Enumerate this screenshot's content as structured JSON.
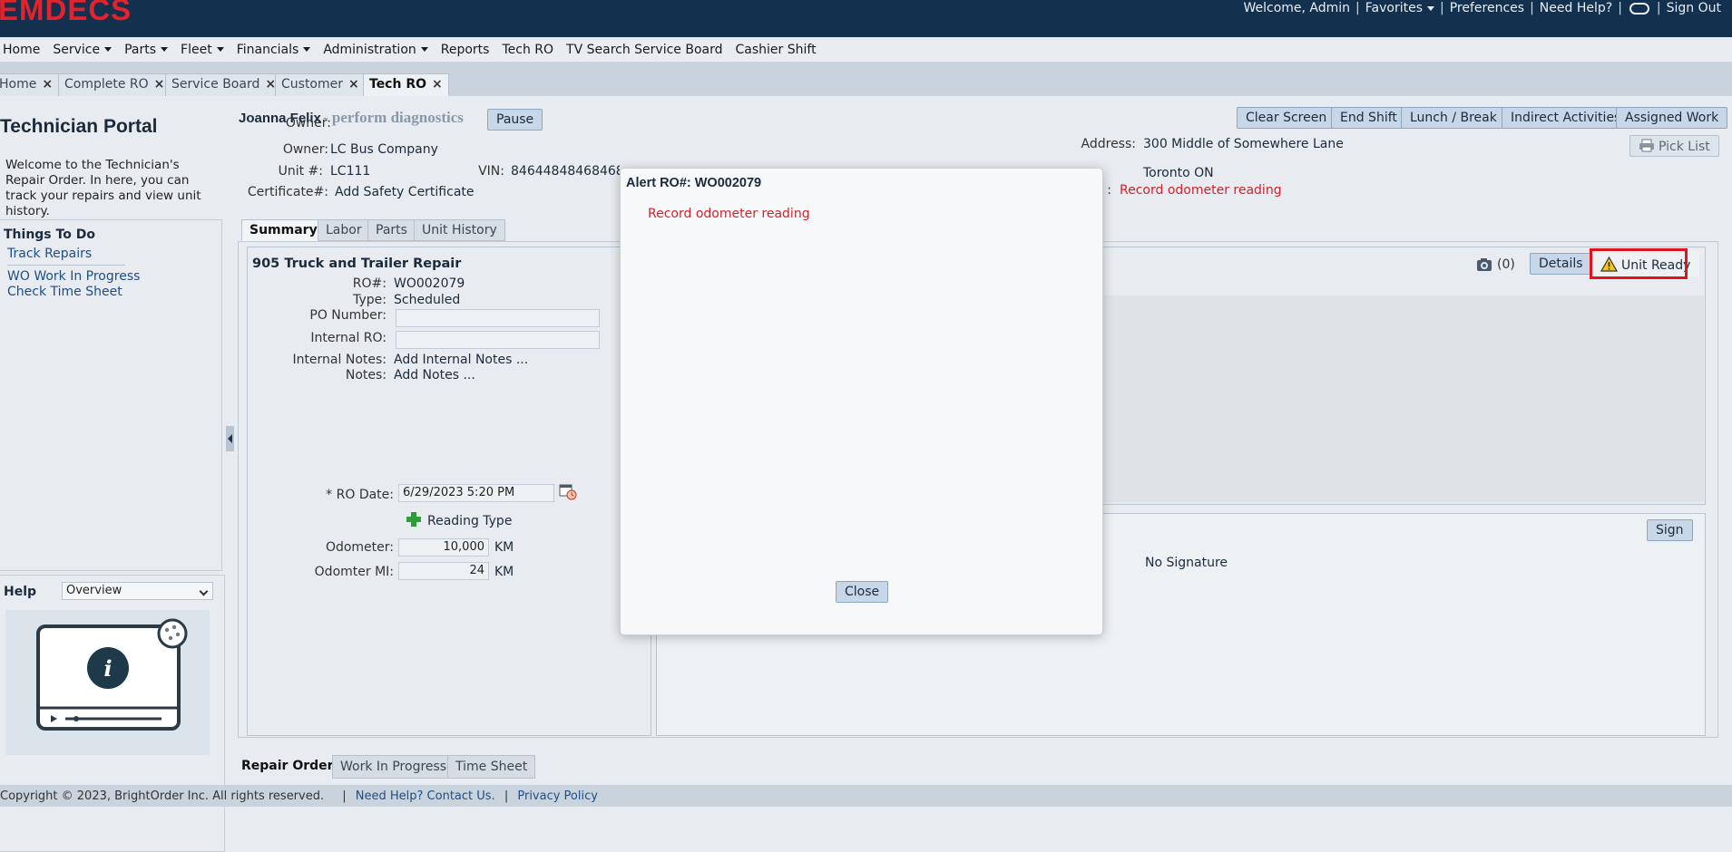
{
  "header": {
    "logo": "EMDECS",
    "welcome": "Welcome, Admin",
    "favorites": "Favorites",
    "preferences": "Preferences",
    "need_help": "Need Help?",
    "sign_out": "Sign Out",
    "separator": "|"
  },
  "menu": {
    "items": [
      "Home",
      "Service",
      "Parts",
      "Fleet",
      "Financials",
      "Administration",
      "Reports",
      "Tech RO",
      "TV Search Service Board",
      "Cashier Shift"
    ]
  },
  "tabs": [
    {
      "label": "Home"
    },
    {
      "label": "Complete RO"
    },
    {
      "label": "Service Board"
    },
    {
      "label": "Customer"
    },
    {
      "label": "Tech RO"
    }
  ],
  "left": {
    "title": "Technician Portal",
    "description": "Welcome to the Technician's Repair Order. In here, you can track your repairs and view unit history.",
    "todo_title": "Things To Do",
    "todo_links": [
      "Track Repairs",
      "WO Work In Progress",
      "Check Time Sheet"
    ],
    "help_title": "Help",
    "help_selected": "Overview"
  },
  "tech": {
    "name": "Joanna Felix",
    "status": "- perform diagnostics",
    "pause_label": "Pause"
  },
  "actions": {
    "clear_screen": "Clear Screen",
    "end_shift": "End Shift",
    "lunch_break": "Lunch / Break",
    "indirect": "Indirect Activities",
    "assigned": "Assigned Work",
    "pick_list": "Pick List"
  },
  "unit": {
    "owner_label": "Owner:",
    "owner": "LC Bus Company",
    "unit_label": "Unit #:",
    "unit": "LC111",
    "vin_label": "VIN:",
    "vin": "8464484846846846846846...",
    "cert_label": "Certificate#:",
    "cert": "Add Safety Certificate",
    "address_label": "Address:",
    "address": "300 Middle of Somewhere Lane",
    "city": "Toronto ON",
    "alert_label": ":",
    "alert": "Record odometer reading"
  },
  "inner_tabs": [
    "Summary",
    "Labor",
    "Parts",
    "Unit History"
  ],
  "summary": {
    "title": "905 Truck and Trailer Repair",
    "ro_label": "RO#:",
    "ro": "WO002079",
    "type_label": "Type:",
    "type": "Scheduled",
    "po_label": "PO Number:",
    "po_value": "",
    "internal_ro_label": "Internal RO:",
    "internal_ro_value": "",
    "internal_notes_label": "Internal Notes:",
    "internal_notes": "Add Internal Notes ...",
    "notes_label": "Notes:",
    "notes": "Add Notes ...",
    "ro_date_label": "* RO Date:",
    "ro_date": "6/29/2023 5:20 PM",
    "reading_type": "Reading Type",
    "odometer_label": "Odometer:",
    "odometer": "10,000",
    "odometer_unit": "KM",
    "odomter_mi_label": "Odomter MI:",
    "odomter_mi": "24",
    "odomter_mi_unit": "KM"
  },
  "right": {
    "photo_count": "(0)",
    "details": "Details",
    "unit_ready": "Unit Ready",
    "sign": "Sign",
    "no_signature": "No Signature"
  },
  "bottom_tabs": [
    "Repair Order",
    "Work In Progress",
    "Time Sheet"
  ],
  "footer": {
    "copyright": "Copyright © 2023, BrightOrder Inc. All rights reserved.",
    "help_link": "Need Help? Contact Us.",
    "privacy": "Privacy Policy",
    "sep": "|"
  },
  "dialog": {
    "title": "Alert RO#: WO002079",
    "message": "Record odometer reading",
    "close": "Close"
  },
  "colors": {
    "topbar": "#13304e",
    "logo": "#e4222c",
    "alert_red": "#d2222a",
    "button": "#c7d7e7"
  }
}
